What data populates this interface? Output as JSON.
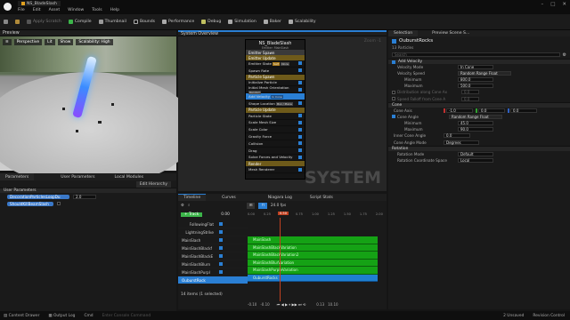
{
  "window": {
    "tab": "NS_BladeSlash",
    "menu": [
      "File",
      "Edit",
      "Asset",
      "Window",
      "Tools",
      "Help"
    ],
    "controls": [
      "–",
      "□",
      "✕"
    ]
  },
  "toolbar": {
    "save": "",
    "apply": "Apply Scratch",
    "compile": "Compile",
    "thumbnail": "Thumbnail",
    "bounds": "Bounds",
    "performance": "Performance",
    "debug": "Debug",
    "simulation": "Simulation",
    "baker": "Baker",
    "scalability": "Scalability"
  },
  "preview": {
    "title": "Preview",
    "perspective": "Perspective",
    "lit": "Lit",
    "show": "Show",
    "scalability": "Scalability: High"
  },
  "params": {
    "tabs": [
      "Parameters",
      "User Parameters",
      "Local Modules"
    ],
    "edit_btn": "Edit Hierarchy",
    "section": "User Parameters",
    "items": [
      {
        "name": "DecorationParticlesLoopDu",
        "value": "2.0"
      },
      {
        "name": "ShouldKillBeamSlash",
        "value": ""
      }
    ]
  },
  "overview": {
    "title": "System Overview",
    "zoom": "Zoom -1",
    "system_name": "NS_BladeSlash",
    "system_sub": "Emitter: MainSlash",
    "watermark": "SYSTEM",
    "sections": [
      {
        "head": "Emitter Spawn",
        "color": "#3a3a3a",
        "rows": []
      },
      {
        "head": "Emitter Update",
        "color": "#6e5a1a",
        "rows": [
          "Emitter State",
          "Spawn Rate"
        ]
      },
      {
        "head": "Particle Spawn",
        "color": "#6e5a1a",
        "rows": [
          "Initialize Particle",
          "Initial Mesh Orientation",
          "Add Velocity",
          "Shape Location"
        ]
      },
      {
        "head": "Particle Update",
        "color": "#6e5a1a",
        "rows": [
          "Particle State",
          "Scale Mesh Size",
          "Scale Color",
          "Gravity Force",
          "Collision",
          "Drag",
          "Solve Forces and Velocity"
        ]
      },
      {
        "head": "Render",
        "color": "#6e5a1a",
        "rows": [
          "Mesh Renderer"
        ]
      }
    ],
    "tags": {
      "emitter_state": "Self",
      "emitter_state2": "Once",
      "mesh_orient": "Random",
      "add_velocity": "In Cone",
      "shape_loc": "Box / Plane"
    }
  },
  "timeline": {
    "tabs": [
      "Timeline",
      "Curves",
      "Niagara Log",
      "Script Stats"
    ],
    "track_btn": "Track",
    "fps": "24.0 fps",
    "frame": "0.00",
    "play_frame": "0.50",
    "start": "-0.10",
    "start2": "-0.10",
    "end": "0.13",
    "end2": "10.10",
    "ruler": [
      "0.00",
      "0.25",
      "0.50",
      "0.75",
      "1.00",
      "1.25",
      "1.50",
      "1.75",
      "2.00"
    ],
    "tracks": [
      "FollowingFlat",
      "LightningStrike",
      "MainSlash",
      "MainSlashBlackf",
      "MainSlashBlackE",
      "MainSlashBlurn",
      "MainSlashPurpl",
      "OuburstRock"
    ],
    "bars": [
      "MainSlash",
      "MainSlashBlackVariation",
      "MainSlashBlackVariation2",
      "MainSlashBlurVariation",
      "MainSlashPurpleVariation",
      "OuburstRocks"
    ],
    "count": "14 items (1 selected)"
  },
  "selection": {
    "tabs": [
      "Selection",
      "Preview Scene S..."
    ],
    "title": "OuburstRocks",
    "sub": "13 Particles",
    "search": "Search",
    "velocity": {
      "head": "Add Velocity",
      "mode_label": "Velocity Mode",
      "mode": "In Cone",
      "speed_label": "Velocity Speed",
      "speed_type": "Random Range Float",
      "min_label": "Minimum",
      "min": "800.0",
      "max_label": "Maximum",
      "max": "500.0",
      "dist_label": "Distribution along Cone Ax",
      "dist": "0.0",
      "falloff_label": "Speed Falloff from Cone A",
      "falloff": "0.0"
    },
    "cone": {
      "head": "Cone",
      "axis_label": "Cone Axis",
      "x": "-1.0",
      "y": "0.0",
      "z": "0.0",
      "angle_label": "Cone Angle",
      "angle_type": "Random Range Float",
      "min_label": "Minimum",
      "min": "45.0",
      "max_label": "Maximum",
      "max": "90.0",
      "inner_label": "Inner Cone Angle",
      "inner": "0.0",
      "mode_label": "Cone Angle Mode",
      "mode": "Degrees"
    },
    "rotation": {
      "head": "Rotation",
      "mode_label": "Rotation Mode",
      "mode": "Default",
      "coord_label": "Rotation Coordinate Space",
      "coord": "Local"
    }
  },
  "status": {
    "drawer": "Content Drawer",
    "output": "Output Log",
    "cmd": "Cmd",
    "console": "Enter Console Command",
    "unsaved": "2 Unsaved",
    "rev": "Revision Control"
  }
}
